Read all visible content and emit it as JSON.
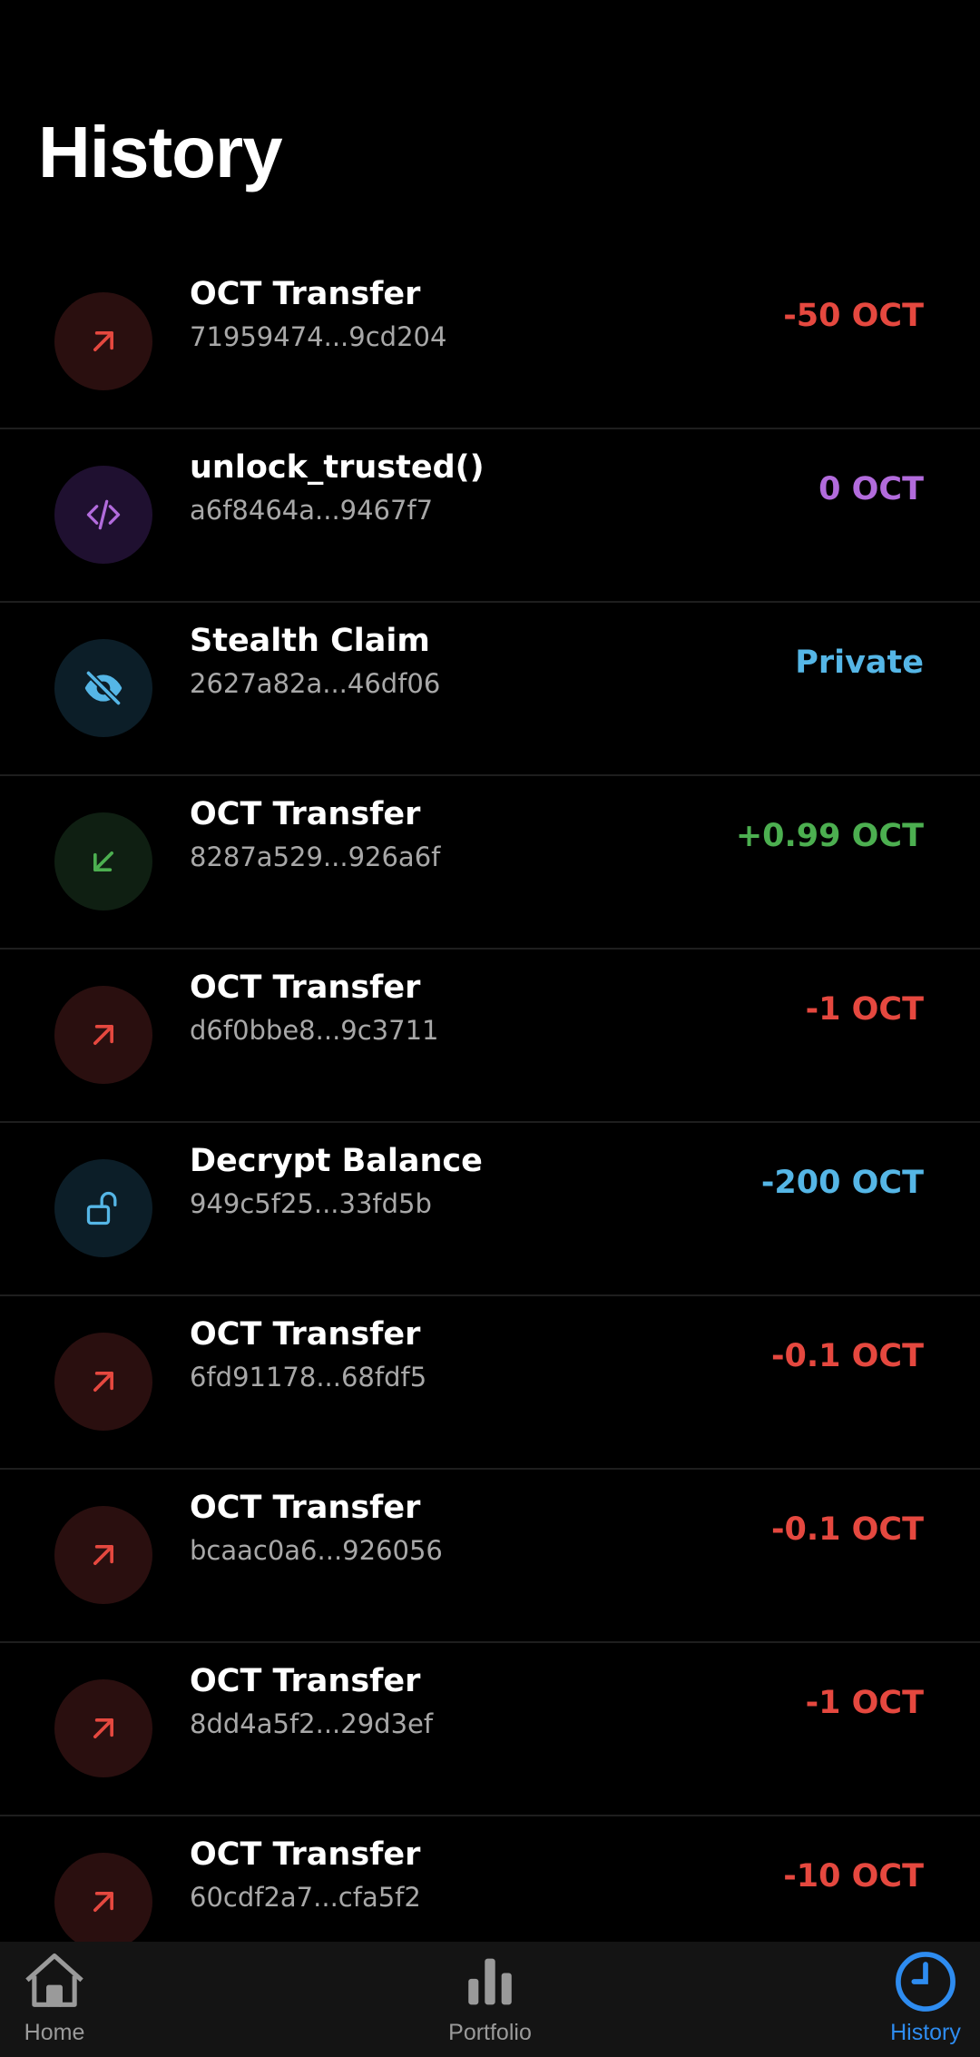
{
  "page": {
    "title": "History"
  },
  "transactions": [
    {
      "title": "OCT Transfer",
      "hash": "71959474...9cd204",
      "amount": "-50 OCT",
      "kind": "send",
      "icon": "arrow-up-right-icon",
      "color": "#e5483f"
    },
    {
      "title": "unlock_trusted()",
      "hash": "a6f8464a...9467f7",
      "amount": "0 OCT",
      "kind": "contract",
      "icon": "code-icon",
      "color": "#b26bdc"
    },
    {
      "title": "Stealth Claim",
      "hash": "2627a82a...46df06",
      "amount": "Private",
      "kind": "stealth",
      "icon": "eye-off-icon",
      "color": "#55b6e6"
    },
    {
      "title": "OCT Transfer",
      "hash": "8287a529...926a6f",
      "amount": "+0.99 OCT",
      "kind": "receive",
      "icon": "arrow-down-left-icon",
      "color": "#4caf50"
    },
    {
      "title": "OCT Transfer",
      "hash": "d6f0bbe8...9c3711",
      "amount": "-1 OCT",
      "kind": "send",
      "icon": "arrow-up-right-icon",
      "color": "#e5483f"
    },
    {
      "title": "Decrypt Balance",
      "hash": "949c5f25...33fd5b",
      "amount": "-200 OCT",
      "kind": "decrypt",
      "icon": "unlock-icon",
      "color": "#55b6e6"
    },
    {
      "title": "OCT Transfer",
      "hash": "6fd91178...68fdf5",
      "amount": "-0.1 OCT",
      "kind": "send",
      "icon": "arrow-up-right-icon",
      "color": "#e5483f"
    },
    {
      "title": "OCT Transfer",
      "hash": "bcaac0a6...926056",
      "amount": "-0.1 OCT",
      "kind": "send",
      "icon": "arrow-up-right-icon",
      "color": "#e5483f"
    },
    {
      "title": "OCT Transfer",
      "hash": "8dd4a5f2...29d3ef",
      "amount": "-1 OCT",
      "kind": "send",
      "icon": "arrow-up-right-icon",
      "color": "#e5483f"
    },
    {
      "title": "OCT Transfer",
      "hash": "60cdf2a7...cfa5f2",
      "amount": "-10 OCT",
      "kind": "send",
      "icon": "arrow-up-right-icon",
      "color": "#e5483f"
    }
  ],
  "nav": {
    "home_label": "Home",
    "portfolio_label": "Portfolio",
    "history_label": "History",
    "active": "History",
    "active_color": "#2e8cf0",
    "inactive_color": "#9a9a9a"
  }
}
